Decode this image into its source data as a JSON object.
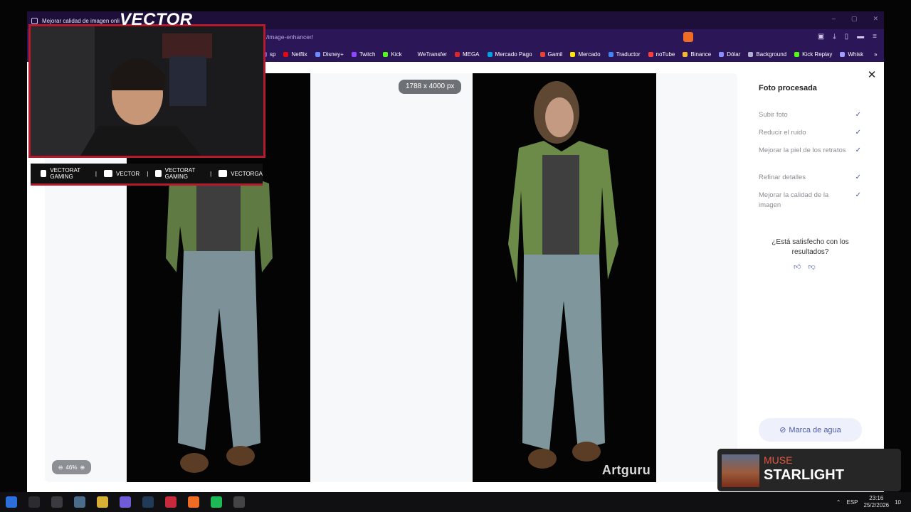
{
  "tab": {
    "title": "Mejorar calidad de imagen onli"
  },
  "address": {
    "url": "/image-enhancer/"
  },
  "window_controls": [
    "–",
    "▢",
    "✕"
  ],
  "bookmarks": [
    {
      "label": "sp",
      "color": "#7a5fd0"
    },
    {
      "label": "Netflix",
      "color": "#e50914"
    },
    {
      "label": "Disney+",
      "color": "#6b8bff"
    },
    {
      "label": "Twitch",
      "color": "#9146ff"
    },
    {
      "label": "Kick",
      "color": "#53fc18"
    },
    {
      "label": "WeTransfer",
      "color": "#2b1658"
    },
    {
      "label": "MEGA",
      "color": "#d9272e"
    },
    {
      "label": "Mercado Pago",
      "color": "#00a3e0"
    },
    {
      "label": "Gamil",
      "color": "#ea4335"
    },
    {
      "label": "Mercado",
      "color": "#ffe600"
    },
    {
      "label": "Traductor",
      "color": "#4285f4"
    },
    {
      "label": "noTube",
      "color": "#ff3d3d"
    },
    {
      "label": "Binance",
      "color": "#f3ba2f"
    },
    {
      "label": "Dólar",
      "color": "#8c8cff"
    },
    {
      "label": "Background",
      "color": "#b0b0d0"
    },
    {
      "label": "Kick Replay",
      "color": "#53fc18"
    },
    {
      "label": "Whisk",
      "color": "#a0a0ff"
    }
  ],
  "bookmarks_more": "»",
  "image": {
    "dimensions": "1788 x 4000 px",
    "watermark": "Artguru",
    "zoom": "46%"
  },
  "panel": {
    "title": "Foto procesada",
    "steps": [
      {
        "label": "Subir foto"
      },
      {
        "label": "Reducir el ruido"
      },
      {
        "label": "Mejorar la piel de los retratos"
      },
      {
        "label": "Refinar detalles"
      },
      {
        "label": "Mejorar la calidad de la imagen"
      }
    ],
    "check_glyph": "✓",
    "satisfied": "¿Está satisfecho con los resultados?",
    "watermark_button": "Marca de agua"
  },
  "webcam": {
    "brand": "VECTOR",
    "socials": [
      {
        "label": "VECTORAT GAMING"
      },
      {
        "label": "VECTOR"
      },
      {
        "label": "VECTORAT GAMING"
      },
      {
        "label": "VECTORGA"
      }
    ]
  },
  "now_playing": {
    "artist": "MUSE",
    "song": "STARLIGHT"
  },
  "taskbar": {
    "lang": "ESP",
    "time": "23:16",
    "date": "25/2/2026",
    "notifications": "10"
  }
}
